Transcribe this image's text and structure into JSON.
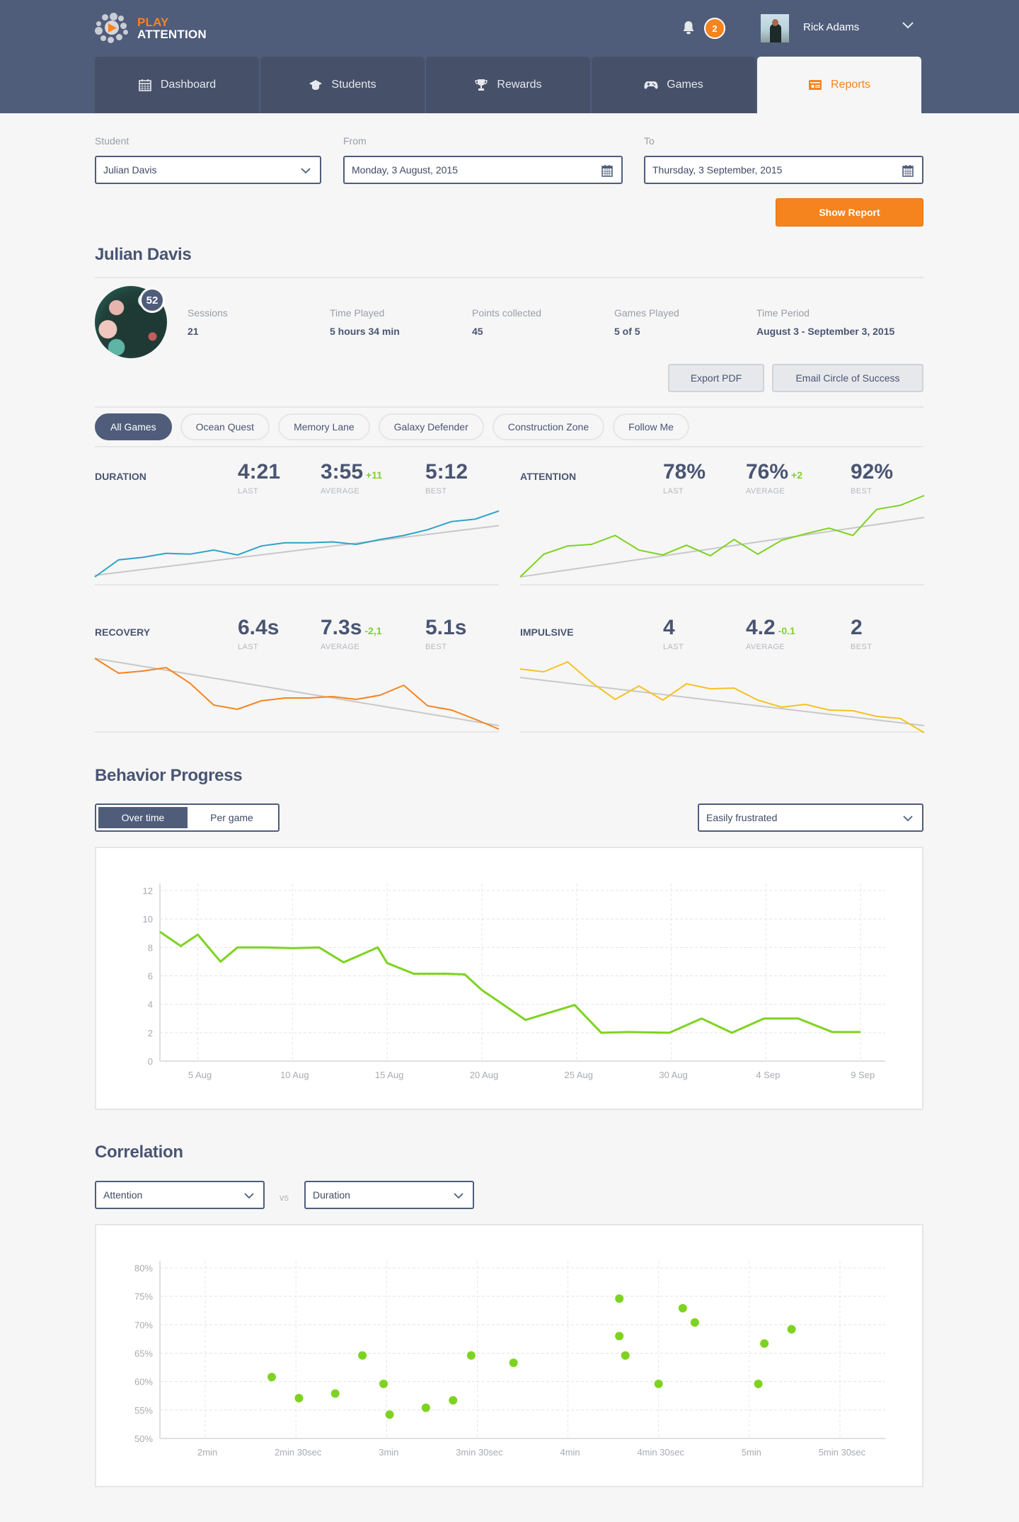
{
  "app": {
    "logo_line1": "PLAY",
    "logo_line2": "ATTENTION"
  },
  "header": {
    "notification_count": "2",
    "user_name": "Rick Adams"
  },
  "tabs": [
    {
      "label": "Dashboard",
      "icon": "calendar-icon",
      "active": false
    },
    {
      "label": "Students",
      "icon": "graduation-cap-icon",
      "active": false
    },
    {
      "label": "Rewards",
      "icon": "trophy-icon",
      "active": false
    },
    {
      "label": "Games",
      "icon": "gamepad-icon",
      "active": false
    },
    {
      "label": "Reports",
      "icon": "report-card-icon",
      "active": true
    }
  ],
  "filters": {
    "student_label": "Student",
    "student_value": "Julian Davis",
    "from_label": "From",
    "from_value": "Monday, 3 August, 2015",
    "to_label": "To",
    "to_value": "Thursday, 3 September, 2015",
    "show_report": "Show Report"
  },
  "profile": {
    "name": "Julian Davis",
    "level": "52",
    "stats": [
      {
        "label": "Sessions",
        "value": "21"
      },
      {
        "label": "Time Played",
        "value": "5 hours 34 min"
      },
      {
        "label": "Points collected",
        "value": "45"
      },
      {
        "label": "Games Played",
        "value": "5 of 5"
      },
      {
        "label": "Time Period",
        "value": "August 3 - September 3, 2015"
      }
    ],
    "export_pdf": "Export PDF",
    "email_circle": "Email Circle of Success"
  },
  "game_filters": [
    {
      "label": "All Games",
      "active": true
    },
    {
      "label": "Ocean Quest",
      "active": false
    },
    {
      "label": "Memory Lane",
      "active": false
    },
    {
      "label": "Galaxy Defender",
      "active": false
    },
    {
      "label": "Construction Zone",
      "active": false
    },
    {
      "label": "Follow Me",
      "active": false
    }
  ],
  "metric_labels": {
    "last": "LAST",
    "average": "AVERAGE",
    "best": "BEST"
  },
  "metrics": [
    {
      "title": "DURATION",
      "last": "4:21",
      "average": "3:55",
      "delta": "+11",
      "best": "5:12",
      "color": "#2ea3c6",
      "series": [
        0,
        21,
        24,
        29,
        28,
        33,
        27,
        38,
        42,
        42,
        43,
        40,
        46,
        51,
        58,
        68,
        71,
        81
      ],
      "trend": [
        2,
        63
      ]
    },
    {
      "title": "ATTENTION",
      "last": "78%",
      "average": "76%",
      "delta": "+2",
      "best": "92%",
      "color": "#7ed321",
      "series": [
        0,
        28,
        38,
        40,
        51,
        33,
        27,
        39,
        26,
        46,
        28,
        45,
        53,
        60,
        51,
        83,
        88,
        100
      ],
      "trend": [
        0,
        73
      ]
    },
    {
      "title": "RECOVERY",
      "last": "6.4s",
      "average": "7.3s",
      "delta": "-2,1",
      "best": "5.1s",
      "color": "#f5841f",
      "series": [
        100,
        79,
        82,
        87,
        65,
        34,
        28,
        40,
        44,
        44,
        46,
        42,
        48,
        62,
        33,
        27,
        14,
        0
      ],
      "trend": [
        100,
        5
      ]
    },
    {
      "title": "IMPULSIVE",
      "last": "4",
      "average": "4.2",
      "delta": "-0.1",
      "best": "2",
      "color": "#f5c222",
      "series": [
        90,
        86,
        100,
        71,
        47,
        66,
        46,
        69,
        62,
        63,
        46,
        36,
        40,
        32,
        31,
        23,
        20,
        0
      ],
      "trend": [
        78,
        10
      ]
    }
  ],
  "behavior": {
    "title": "Behavior Progress",
    "toggle": [
      "Over time",
      "Per game"
    ],
    "toggle_active": 0,
    "select_value": "Easily frustrated"
  },
  "correlation": {
    "title": "Correlation",
    "x_select": "Attention",
    "vs": "vs",
    "y_select": "Duration"
  },
  "chart_data": [
    {
      "type": "line",
      "title": "Behavior Progress - Easily frustrated",
      "color": "#7ed321",
      "xlabel": "",
      "ylabel": "",
      "x_unit": "day-of-period (0 = 3 Aug)",
      "ylim": [
        0,
        12
      ],
      "yticks": [
        0,
        2,
        4,
        6,
        8,
        10,
        12
      ],
      "xticks": [
        {
          "day": 2,
          "label": "5 Aug"
        },
        {
          "day": 7,
          "label": "10 Aug"
        },
        {
          "day": 12,
          "label": "15 Aug"
        },
        {
          "day": 17,
          "label": "20 Aug"
        },
        {
          "day": 22,
          "label": "25 Aug"
        },
        {
          "day": 27,
          "label": "30 Aug"
        },
        {
          "day": 32,
          "label": "4 Sep"
        },
        {
          "day": 37,
          "label": "9 Sep"
        }
      ],
      "xlim": [
        0,
        38.3
      ],
      "grid": true,
      "points": [
        [
          0,
          9.1
        ],
        [
          1.1,
          8.1
        ],
        [
          2,
          8.9
        ],
        [
          3.2,
          7.0
        ],
        [
          4.1,
          8.0
        ],
        [
          5.5,
          8.0
        ],
        [
          7,
          7.95
        ],
        [
          8.4,
          8.0
        ],
        [
          9.7,
          6.95
        ],
        [
          11.5,
          8.0
        ],
        [
          12,
          6.9
        ],
        [
          13.4,
          6.15
        ],
        [
          15.2,
          6.15
        ],
        [
          16.1,
          6.1
        ],
        [
          17,
          5.0
        ],
        [
          18.1,
          4.0
        ],
        [
          19.3,
          2.9
        ],
        [
          21.9,
          3.95
        ],
        [
          23.3,
          2.0
        ],
        [
          24.7,
          2.05
        ],
        [
          26.9,
          2.0
        ],
        [
          28.6,
          3.0
        ],
        [
          30.2,
          2.0
        ],
        [
          31.9,
          3.0
        ],
        [
          33.7,
          3.0
        ],
        [
          35.5,
          2.05
        ],
        [
          37,
          2.05
        ]
      ]
    },
    {
      "type": "scatter",
      "title": "Correlation - Attention vs Duration",
      "color": "#7ed321",
      "xlabel": "Duration",
      "ylabel": "Attention",
      "xlim": [
        105,
        345
      ],
      "ylim": [
        50,
        80
      ],
      "yticks": [
        {
          "v": 50,
          "label": "50%"
        },
        {
          "v": 55,
          "label": "55%"
        },
        {
          "v": 60,
          "label": "60%"
        },
        {
          "v": 65,
          "label": "65%"
        },
        {
          "v": 70,
          "label": "70%"
        },
        {
          "v": 75,
          "label": "75%"
        },
        {
          "v": 80,
          "label": "80%"
        }
      ],
      "xticks": [
        {
          "v": 120,
          "label": "2min"
        },
        {
          "v": 150,
          "label": "2min 30sec"
        },
        {
          "v": 180,
          "label": "3min"
        },
        {
          "v": 210,
          "label": "3min 30sec"
        },
        {
          "v": 240,
          "label": "4min"
        },
        {
          "v": 270,
          "label": "4min 30sec"
        },
        {
          "v": 300,
          "label": "5min"
        },
        {
          "v": 330,
          "label": "5min 30sec"
        }
      ],
      "grid": true,
      "points": [
        [
          142,
          60.8
        ],
        [
          151,
          57.1
        ],
        [
          163,
          57.9
        ],
        [
          172,
          64.6
        ],
        [
          179,
          59.6
        ],
        [
          181,
          54.2
        ],
        [
          193,
          55.4
        ],
        [
          202,
          56.7
        ],
        [
          208,
          64.6
        ],
        [
          222,
          63.3
        ],
        [
          257,
          74.6
        ],
        [
          257,
          68.0
        ],
        [
          259,
          64.6
        ],
        [
          270,
          59.6
        ],
        [
          278,
          72.9
        ],
        [
          282,
          70.4
        ],
        [
          303,
          59.6
        ],
        [
          305,
          66.7
        ],
        [
          314,
          69.2
        ]
      ]
    }
  ]
}
